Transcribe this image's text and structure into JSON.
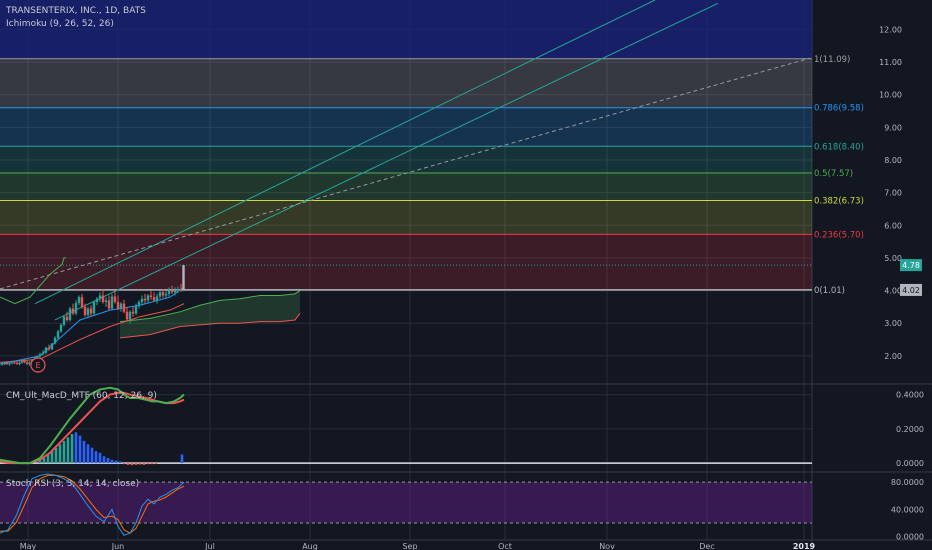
{
  "header": {
    "symbol_title": "TRANSENTERIX, INC., 1D, BATS",
    "ichimoku_label": "Ichimoku (9, 26, 52, 26)"
  },
  "colors": {
    "background": "#131722",
    "up_candle": "#26a69a",
    "down_candle": "#ef5350",
    "grid": "#2a2e39",
    "macd_line": "#4caf50",
    "signal_line": "#ef5350",
    "histogram": "#2196f3",
    "stoch_k": "#2196f3",
    "stoch_d": "#ff6d00",
    "stoch_band": "#7b1fa2"
  },
  "chart_data": [
    {
      "type": "candlestick",
      "title": "TRANSENTERIX, INC., 1D, BATS",
      "x_ticks": [
        "May",
        "Jun",
        "Jul",
        "Aug",
        "Sep",
        "Oct",
        "Nov",
        "Dec",
        "2019"
      ],
      "y_ticks": [
        "2.00",
        "3.00",
        "4.00",
        "5.00",
        "6.00",
        "7.00",
        "8.00",
        "9.00",
        "10.00",
        "11.00",
        "12.00"
      ],
      "ylim": [
        1.2,
        12.9
      ],
      "price_labels": [
        {
          "text": "4.78",
          "value": 4.78
        },
        {
          "text": "4.02",
          "value": 4.02
        }
      ],
      "fib_levels": [
        {
          "label": "0(1.01)",
          "value": 4.02,
          "color": "#b2b5be"
        },
        {
          "label": "0.236(5.70)",
          "value": 5.72,
          "color": "#f23645"
        },
        {
          "label": "0.382(6.73)",
          "value": 6.76,
          "color": "#cddc39"
        },
        {
          "label": "0.5(7.57)",
          "value": 7.6,
          "color": "#4caf50"
        },
        {
          "label": "0.618(8.40)",
          "value": 8.42,
          "color": "#26a69a"
        },
        {
          "label": "0.786(9.58)",
          "value": 9.6,
          "color": "#2196f3"
        },
        {
          "label": "1(11.09)",
          "value": 11.1,
          "color": "#9e9e9e"
        }
      ],
      "candles": [
        {
          "x": 2.0,
          "o": 1.75,
          "h": 1.8,
          "l": 1.7,
          "c": 1.76
        },
        {
          "x": 4.5,
          "o": 1.76,
          "h": 1.82,
          "l": 1.72,
          "c": 1.78
        },
        {
          "x": 7.0,
          "o": 1.78,
          "h": 1.83,
          "l": 1.73,
          "c": 1.74
        },
        {
          "x": 9.5,
          "o": 1.74,
          "h": 1.8,
          "l": 1.7,
          "c": 1.77
        },
        {
          "x": 12.0,
          "o": 1.77,
          "h": 1.85,
          "l": 1.74,
          "c": 1.8
        },
        {
          "x": 14.5,
          "o": 1.8,
          "h": 1.86,
          "l": 1.76,
          "c": 1.78
        },
        {
          "x": 17.0,
          "o": 1.78,
          "h": 1.84,
          "l": 1.73,
          "c": 1.75
        },
        {
          "x": 19.5,
          "o": 1.75,
          "h": 1.82,
          "l": 1.71,
          "c": 1.79
        },
        {
          "x": 22.0,
          "o": 1.79,
          "h": 1.88,
          "l": 1.76,
          "c": 1.84
        },
        {
          "x": 24.5,
          "o": 1.84,
          "h": 1.9,
          "l": 1.78,
          "c": 1.8
        },
        {
          "x": 27.0,
          "o": 1.8,
          "h": 1.86,
          "l": 1.72,
          "c": 1.76
        },
        {
          "x": 29.5,
          "o": 1.76,
          "h": 1.83,
          "l": 1.7,
          "c": 1.8
        },
        {
          "x": 32.0,
          "o": 1.8,
          "h": 1.9,
          "l": 1.77,
          "c": 1.86
        },
        {
          "x": 34.5,
          "o": 1.86,
          "h": 1.95,
          "l": 1.82,
          "c": 1.92
        },
        {
          "x": 37.0,
          "o": 1.92,
          "h": 2.02,
          "l": 1.88,
          "c": 1.98
        },
        {
          "x": 40.0,
          "o": 1.98,
          "h": 2.1,
          "l": 1.95,
          "c": 2.05
        },
        {
          "x": 43.0,
          "o": 2.05,
          "h": 2.18,
          "l": 2.02,
          "c": 2.1
        },
        {
          "x": 46.0,
          "o": 2.1,
          "h": 2.28,
          "l": 2.05,
          "c": 2.25
        },
        {
          "x": 49.0,
          "o": 2.25,
          "h": 2.35,
          "l": 2.15,
          "c": 2.2
        },
        {
          "x": 52.0,
          "o": 2.2,
          "h": 2.4,
          "l": 2.18,
          "c": 2.38
        },
        {
          "x": 55.0,
          "o": 2.38,
          "h": 2.6,
          "l": 2.35,
          "c": 2.55
        },
        {
          "x": 58.0,
          "o": 2.55,
          "h": 2.8,
          "l": 2.5,
          "c": 2.75
        },
        {
          "x": 61.0,
          "o": 2.75,
          "h": 3.0,
          "l": 2.7,
          "c": 2.95
        },
        {
          "x": 64.0,
          "o": 2.95,
          "h": 3.25,
          "l": 2.9,
          "c": 3.2
        },
        {
          "x": 67.0,
          "o": 3.2,
          "h": 3.35,
          "l": 3.05,
          "c": 3.1
        },
        {
          "x": 70.0,
          "o": 3.1,
          "h": 3.5,
          "l": 3.05,
          "c": 3.45
        },
        {
          "x": 73.0,
          "o": 3.45,
          "h": 3.6,
          "l": 3.25,
          "c": 3.3
        },
        {
          "x": 76.0,
          "o": 3.3,
          "h": 3.7,
          "l": 3.25,
          "c": 3.62
        },
        {
          "x": 79.0,
          "o": 3.62,
          "h": 3.85,
          "l": 3.55,
          "c": 3.8
        },
        {
          "x": 82.0,
          "o": 3.8,
          "h": 3.9,
          "l": 3.45,
          "c": 3.5
        },
        {
          "x": 85.0,
          "o": 3.5,
          "h": 3.6,
          "l": 3.2,
          "c": 3.25
        },
        {
          "x": 88.0,
          "o": 3.25,
          "h": 3.5,
          "l": 3.15,
          "c": 3.45
        },
        {
          "x": 91.0,
          "o": 3.45,
          "h": 3.55,
          "l": 3.2,
          "c": 3.3
        },
        {
          "x": 94.0,
          "o": 3.3,
          "h": 3.7,
          "l": 3.25,
          "c": 3.65
        },
        {
          "x": 97.0,
          "o": 3.65,
          "h": 3.8,
          "l": 3.55,
          "c": 3.75
        },
        {
          "x": 100.0,
          "o": 3.75,
          "h": 3.95,
          "l": 3.65,
          "c": 3.85
        },
        {
          "x": 103.0,
          "o": 3.85,
          "h": 4.05,
          "l": 3.6,
          "c": 3.65
        },
        {
          "x": 106.0,
          "o": 3.65,
          "h": 3.8,
          "l": 3.5,
          "c": 3.7
        },
        {
          "x": 109.0,
          "o": 3.7,
          "h": 3.85,
          "l": 3.4,
          "c": 3.45
        },
        {
          "x": 112.0,
          "o": 3.45,
          "h": 3.9,
          "l": 3.4,
          "c": 3.82
        },
        {
          "x": 115.0,
          "o": 3.82,
          "h": 4.0,
          "l": 3.6,
          "c": 3.65
        },
        {
          "x": 118.0,
          "o": 3.65,
          "h": 3.85,
          "l": 3.4,
          "c": 3.45
        },
        {
          "x": 121.0,
          "o": 3.45,
          "h": 3.65,
          "l": 3.35,
          "c": 3.6
        },
        {
          "x": 124.0,
          "o": 3.6,
          "h": 3.72,
          "l": 3.3,
          "c": 3.35
        },
        {
          "x": 127.0,
          "o": 3.35,
          "h": 3.5,
          "l": 3.05,
          "c": 3.12
        },
        {
          "x": 130.0,
          "o": 3.12,
          "h": 3.4,
          "l": 3.0,
          "c": 3.35
        },
        {
          "x": 133.0,
          "o": 3.35,
          "h": 3.5,
          "l": 3.2,
          "c": 3.3
        },
        {
          "x": 136.0,
          "o": 3.3,
          "h": 3.6,
          "l": 3.25,
          "c": 3.55
        },
        {
          "x": 139.0,
          "o": 3.55,
          "h": 3.7,
          "l": 3.45,
          "c": 3.65
        },
        {
          "x": 142.0,
          "o": 3.65,
          "h": 3.85,
          "l": 3.55,
          "c": 3.75
        },
        {
          "x": 145.0,
          "o": 3.75,
          "h": 3.9,
          "l": 3.6,
          "c": 3.7
        },
        {
          "x": 148.0,
          "o": 3.7,
          "h": 3.9,
          "l": 3.62,
          "c": 3.85
        },
        {
          "x": 151.0,
          "o": 3.85,
          "h": 4.0,
          "l": 3.72,
          "c": 3.8
        },
        {
          "x": 154.0,
          "o": 3.8,
          "h": 3.95,
          "l": 3.65,
          "c": 3.7
        },
        {
          "x": 157.0,
          "o": 3.7,
          "h": 3.9,
          "l": 3.6,
          "c": 3.82
        },
        {
          "x": 160.0,
          "o": 3.82,
          "h": 4.0,
          "l": 3.75,
          "c": 3.95
        },
        {
          "x": 163.0,
          "o": 3.95,
          "h": 4.05,
          "l": 3.78,
          "c": 3.85
        },
        {
          "x": 166.0,
          "o": 3.85,
          "h": 4.0,
          "l": 3.75,
          "c": 3.9
        },
        {
          "x": 169.0,
          "o": 3.9,
          "h": 4.1,
          "l": 3.82,
          "c": 4.02
        },
        {
          "x": 172.0,
          "o": 4.02,
          "h": 4.15,
          "l": 3.9,
          "c": 3.95
        },
        {
          "x": 175.0,
          "o": 3.95,
          "h": 4.1,
          "l": 3.85,
          "c": 4.0
        },
        {
          "x": 178.0,
          "o": 4.0,
          "h": 4.12,
          "l": 3.92,
          "c": 4.05
        },
        {
          "x": 181.0,
          "o": 4.05,
          "h": 4.2,
          "l": 3.96,
          "c": 4.02
        },
        {
          "x": 183.5,
          "o": 4.02,
          "h": 4.8,
          "l": 3.98,
          "c": 4.78
        }
      ],
      "markers": [
        {
          "text": "E",
          "x": 38,
          "value": 1.72
        }
      ]
    },
    {
      "type": "bar+line",
      "title": "CM_Ult_MacD_MTF (60, 12, 26, 9)",
      "y_ticks": [
        "0.0000",
        "0.2000",
        "0.4000"
      ],
      "ylim": [
        -0.04,
        0.45
      ],
      "macd": [
        [
          0,
          0.02
        ],
        [
          10,
          0.01
        ],
        [
          20,
          0.0
        ],
        [
          30,
          0.0
        ],
        [
          40,
          0.03
        ],
        [
          50,
          0.1
        ],
        [
          60,
          0.18
        ],
        [
          70,
          0.26
        ],
        [
          80,
          0.33
        ],
        [
          90,
          0.4
        ],
        [
          100,
          0.43
        ],
        [
          110,
          0.44
        ],
        [
          118,
          0.43
        ],
        [
          124,
          0.4
        ],
        [
          130,
          0.38
        ],
        [
          138,
          0.38
        ],
        [
          146,
          0.37
        ],
        [
          152,
          0.36
        ],
        [
          158,
          0.36
        ],
        [
          166,
          0.35
        ],
        [
          174,
          0.36
        ],
        [
          180,
          0.38
        ],
        [
          184,
          0.4
        ]
      ],
      "signal": [
        [
          0,
          0.01
        ],
        [
          10,
          0.0
        ],
        [
          20,
          0.0
        ],
        [
          30,
          0.0
        ],
        [
          40,
          0.02
        ],
        [
          50,
          0.06
        ],
        [
          60,
          0.12
        ],
        [
          70,
          0.18
        ],
        [
          80,
          0.24
        ],
        [
          90,
          0.3
        ],
        [
          100,
          0.36
        ],
        [
          110,
          0.4
        ],
        [
          118,
          0.41
        ],
        [
          124,
          0.41
        ],
        [
          130,
          0.4
        ],
        [
          138,
          0.39
        ],
        [
          146,
          0.38
        ],
        [
          152,
          0.37
        ],
        [
          158,
          0.36
        ],
        [
          166,
          0.35
        ],
        [
          174,
          0.35
        ],
        [
          180,
          0.36
        ],
        [
          184,
          0.37
        ]
      ],
      "histogram": [
        [
          40,
          0.02
        ],
        [
          44,
          0.03
        ],
        [
          48,
          0.05
        ],
        [
          52,
          0.07
        ],
        [
          56,
          0.09
        ],
        [
          60,
          0.11
        ],
        [
          64,
          0.13
        ],
        [
          68,
          0.15
        ],
        [
          72,
          0.17
        ],
        [
          76,
          0.18
        ],
        [
          80,
          0.16
        ],
        [
          84,
          0.13
        ],
        [
          88,
          0.11
        ],
        [
          92,
          0.09
        ],
        [
          96,
          0.07
        ],
        [
          100,
          0.06
        ],
        [
          104,
          0.04
        ],
        [
          108,
          0.03
        ],
        [
          112,
          0.02
        ],
        [
          116,
          0.015
        ],
        [
          120,
          0.01
        ],
        [
          124,
          -0.005
        ],
        [
          128,
          -0.01
        ],
        [
          132,
          -0.012
        ],
        [
          136,
          -0.01
        ],
        [
          140,
          -0.008
        ],
        [
          144,
          -0.01
        ],
        [
          148,
          -0.006
        ],
        [
          152,
          -0.004
        ],
        [
          156,
          -0.003
        ],
        [
          182,
          0.05
        ]
      ]
    },
    {
      "type": "line",
      "title": "Stoch RSI (3, 3, 14, 14, close)",
      "y_ticks": [
        "0.0000",
        "40.0000",
        "80.0000"
      ],
      "ylim": [
        -5,
        92
      ],
      "band": [
        20,
        80
      ],
      "k": [
        [
          0,
          5
        ],
        [
          8,
          10
        ],
        [
          16,
          30
        ],
        [
          24,
          60
        ],
        [
          32,
          85
        ],
        [
          40,
          90
        ],
        [
          48,
          92
        ],
        [
          56,
          90
        ],
        [
          64,
          85
        ],
        [
          72,
          78
        ],
        [
          80,
          62
        ],
        [
          88,
          45
        ],
        [
          96,
          30
        ],
        [
          104,
          22
        ],
        [
          112,
          40
        ],
        [
          118,
          15
        ],
        [
          124,
          2
        ],
        [
          130,
          5
        ],
        [
          136,
          20
        ],
        [
          142,
          45
        ],
        [
          148,
          55
        ],
        [
          154,
          48
        ],
        [
          160,
          58
        ],
        [
          166,
          62
        ],
        [
          172,
          68
        ],
        [
          178,
          72
        ],
        [
          184,
          80
        ]
      ],
      "d": [
        [
          0,
          8
        ],
        [
          8,
          8
        ],
        [
          16,
          20
        ],
        [
          24,
          45
        ],
        [
          32,
          72
        ],
        [
          40,
          85
        ],
        [
          48,
          90
        ],
        [
          56,
          90
        ],
        [
          64,
          88
        ],
        [
          72,
          82
        ],
        [
          80,
          70
        ],
        [
          88,
          55
        ],
        [
          96,
          40
        ],
        [
          104,
          28
        ],
        [
          112,
          30
        ],
        [
          118,
          25
        ],
        [
          124,
          10
        ],
        [
          130,
          5
        ],
        [
          136,
          12
        ],
        [
          142,
          30
        ],
        [
          148,
          48
        ],
        [
          154,
          52
        ],
        [
          160,
          54
        ],
        [
          166,
          58
        ],
        [
          172,
          64
        ],
        [
          178,
          70
        ],
        [
          184,
          74
        ]
      ]
    }
  ],
  "indicators": {
    "macd_label": "CM_Ult_MacD_MTF (60, 12, 26, 9)",
    "stoch_label": "Stoch RSI (3, 3, 14, 14, close)"
  }
}
